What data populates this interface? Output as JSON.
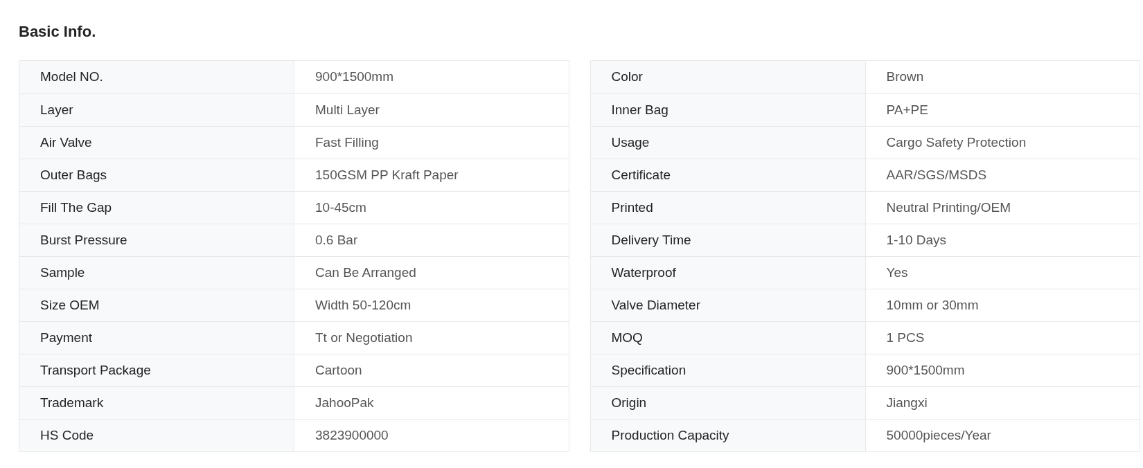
{
  "title": "Basic Info.",
  "tables": [
    {
      "rows": [
        {
          "label": "Model NO.",
          "value": "900*1500mm"
        },
        {
          "label": "Layer",
          "value": "Multi Layer"
        },
        {
          "label": "Air Valve",
          "value": "Fast Filling"
        },
        {
          "label": "Outer Bags",
          "value": "150GSM PP Kraft Paper"
        },
        {
          "label": "Fill The Gap",
          "value": "10-45cm"
        },
        {
          "label": "Burst Pressure",
          "value": "0.6 Bar"
        },
        {
          "label": "Sample",
          "value": "Can Be Arranged"
        },
        {
          "label": "Size OEM",
          "value": "Width 50-120cm"
        },
        {
          "label": "Payment",
          "value": "Tt or Negotiation"
        },
        {
          "label": "Transport Package",
          "value": "Cartoon"
        },
        {
          "label": "Trademark",
          "value": "JahooPak"
        },
        {
          "label": "HS Code",
          "value": "3823900000"
        }
      ]
    },
    {
      "rows": [
        {
          "label": "Color",
          "value": "Brown"
        },
        {
          "label": "Inner Bag",
          "value": "PA+PE"
        },
        {
          "label": "Usage",
          "value": "Cargo Safety Protection"
        },
        {
          "label": "Certificate",
          "value": "AAR/SGS/MSDS"
        },
        {
          "label": "Printed",
          "value": "Neutral Printing/OEM"
        },
        {
          "label": "Delivery Time",
          "value": "1-10 Days"
        },
        {
          "label": "Waterproof",
          "value": "Yes"
        },
        {
          "label": "Valve Diameter",
          "value": "10mm or 30mm"
        },
        {
          "label": "MOQ",
          "value": "1 PCS"
        },
        {
          "label": "Specification",
          "value": "900*1500mm"
        },
        {
          "label": "Origin",
          "value": "Jiangxi"
        },
        {
          "label": "Production Capacity",
          "value": "50000pieces/Year"
        }
      ]
    }
  ]
}
